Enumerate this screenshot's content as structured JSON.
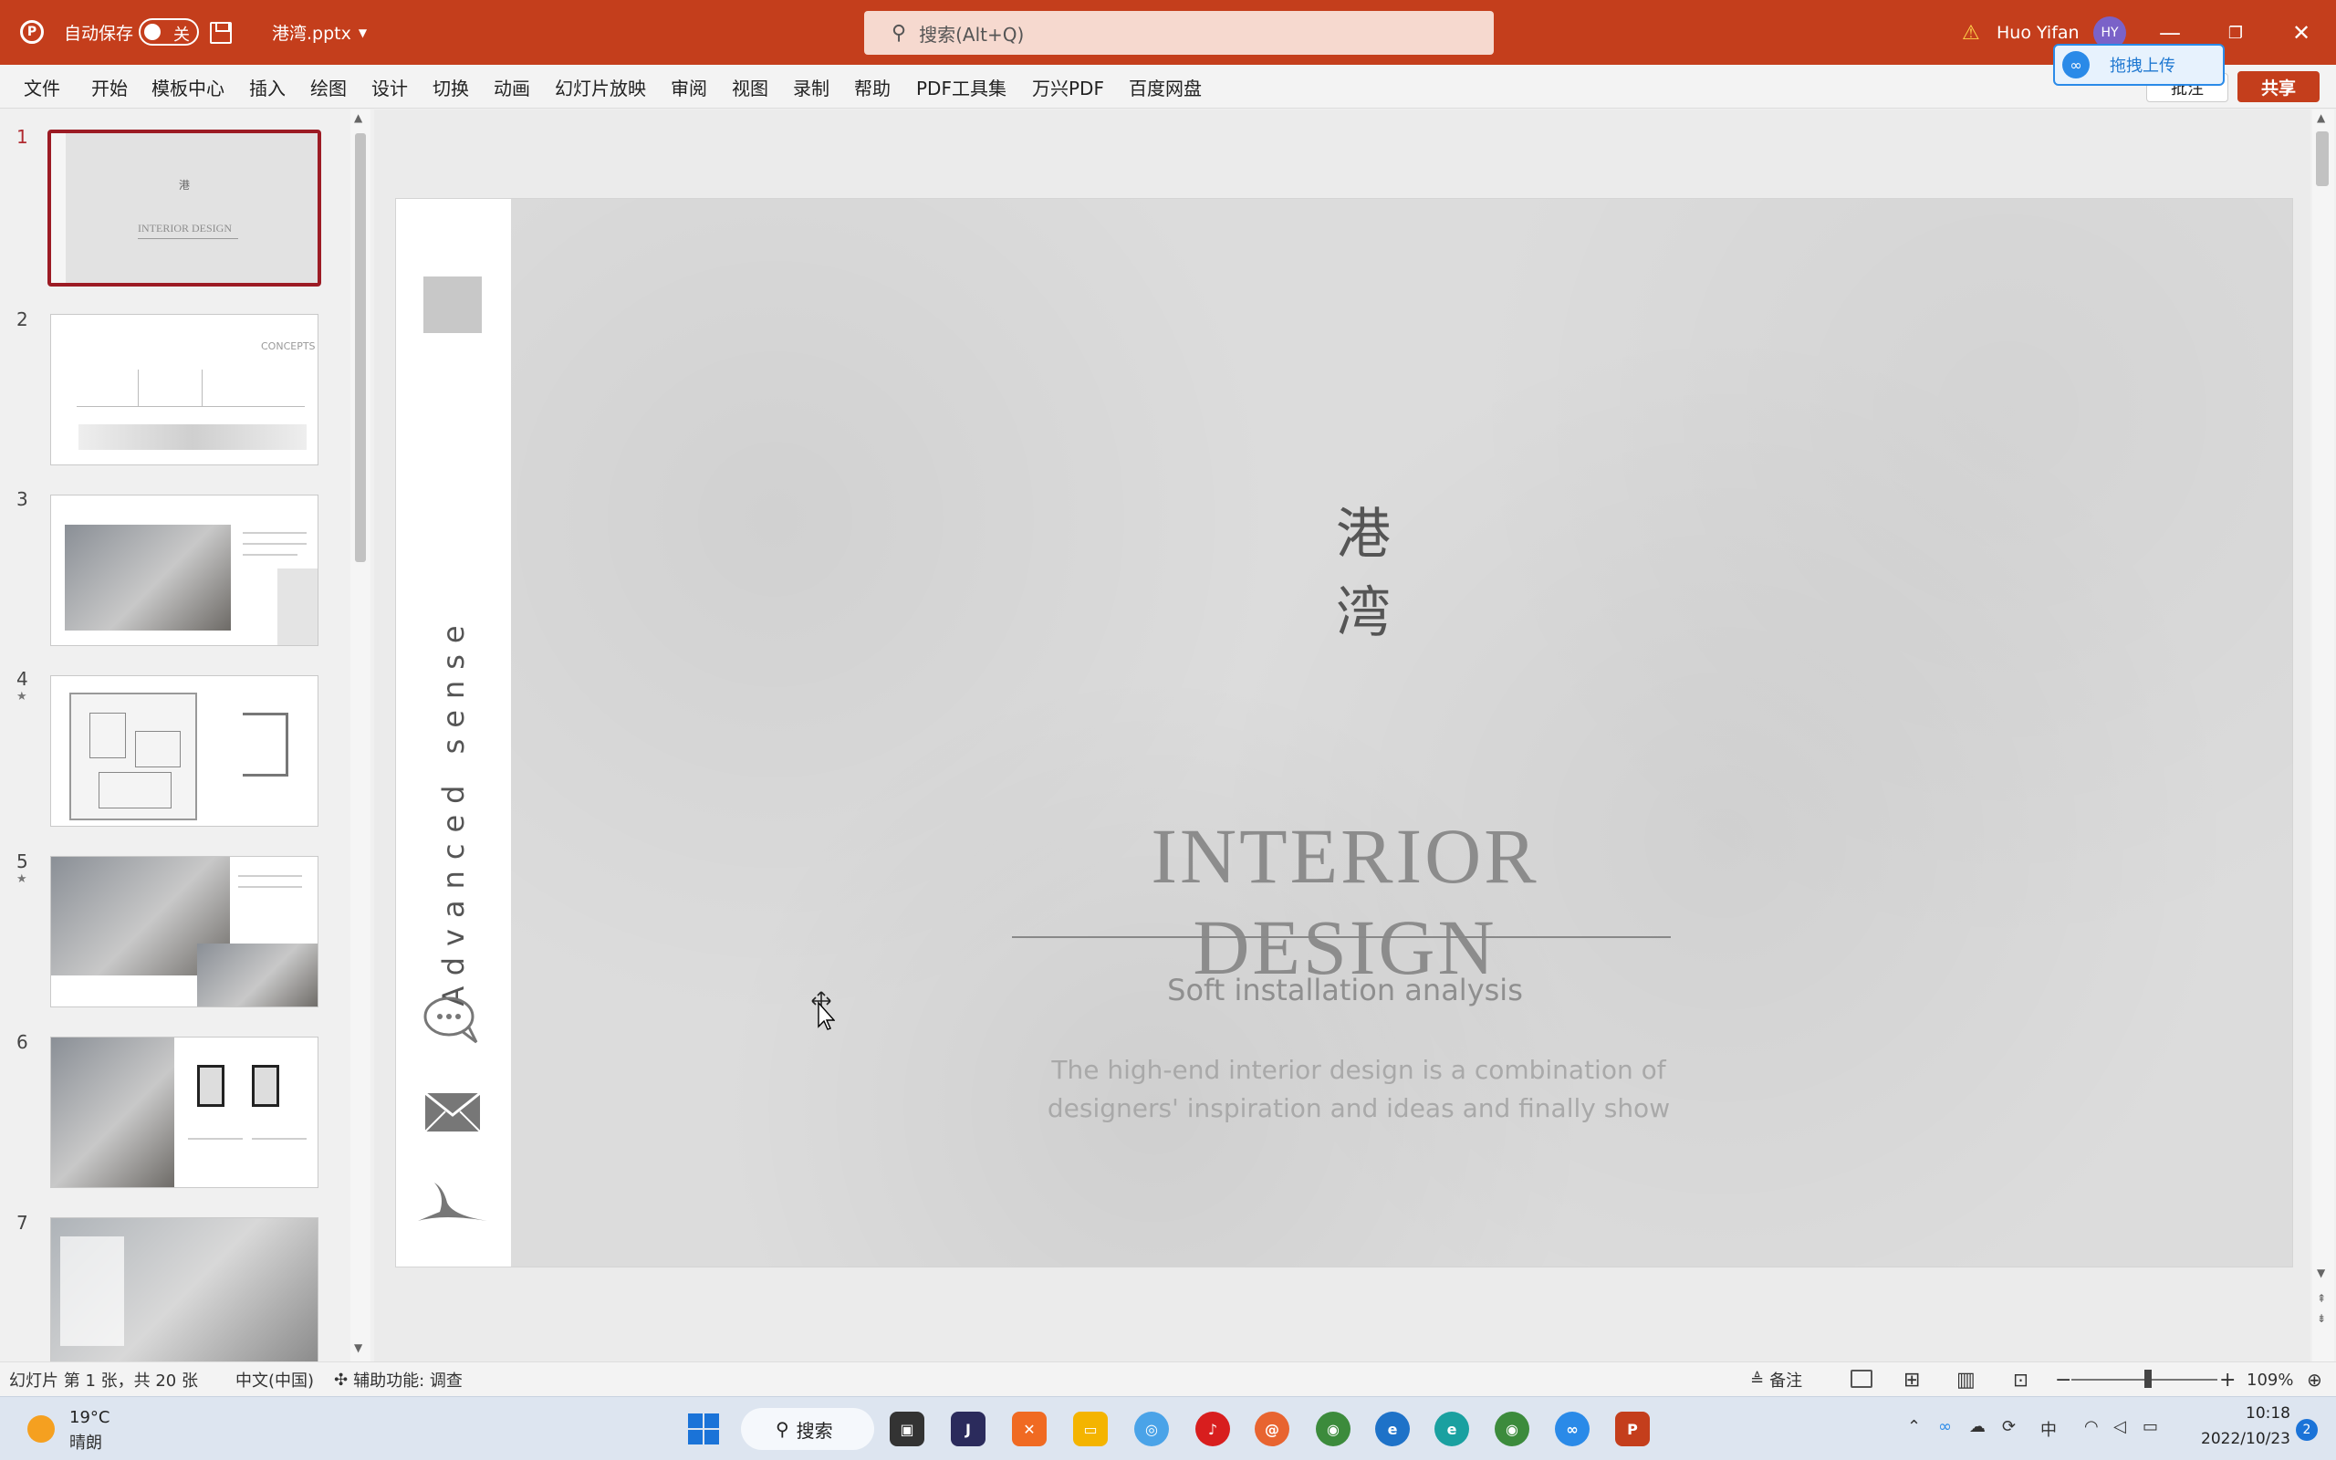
{
  "titlebar": {
    "autosave_label": "自动保存",
    "autosave_state": "关",
    "filename": "港湾.pptx",
    "search_placeholder": "搜索(Alt+Q)",
    "user_name": "Huo Yifan",
    "user_initials": "HY",
    "accent_color": "#c43e1c"
  },
  "ribbon": {
    "tabs": [
      "文件",
      "开始",
      "模板中心",
      "插入",
      "绘图",
      "设计",
      "切换",
      "动画",
      "幻灯片放映",
      "审阅",
      "视图",
      "录制",
      "帮助",
      "PDF工具集",
      "万兴PDF",
      "百度网盘"
    ],
    "upload_label": "拖拽上传",
    "comment_label": "批注",
    "share_label": "共享"
  },
  "thumbnails": {
    "numbers": [
      "1",
      "2",
      "3",
      "4",
      "5",
      "6",
      "7"
    ],
    "selected_index": 1,
    "slide2_heading": "CONCEPTS"
  },
  "slide": {
    "chinese_title_1": "港",
    "chinese_title_2": "湾",
    "title": "INTERIOR  DESIGN",
    "subtitle": "Soft installation analysis",
    "description": "The high-end interior design is a combination of designers' inspiration and ideas and finally show",
    "sidebar_vertical_text": "Advanced    sense"
  },
  "statusbar": {
    "slide_info": "幻灯片 第 1 张，共 20 张",
    "language": "中文(中国)",
    "accessibility": "辅助功能: 调查",
    "notes_label": "备注",
    "zoom": "109%"
  },
  "taskbar": {
    "weather_temp": "19°C",
    "weather_desc": "晴朗",
    "search_label": "搜索",
    "ime": "中",
    "time": "10:18",
    "date": "2022/10/23",
    "notification_count": "2"
  }
}
